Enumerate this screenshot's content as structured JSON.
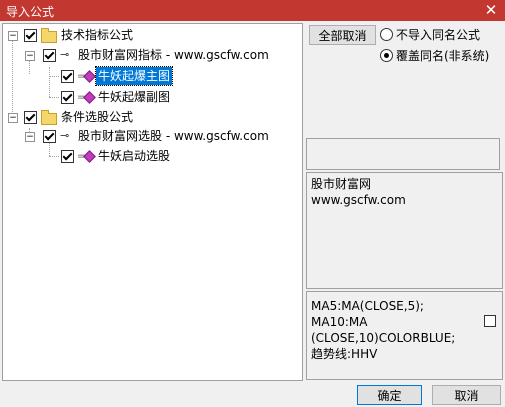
{
  "window": {
    "title": "导入公式",
    "close_glyph": "✕"
  },
  "tree": {
    "nodes": [
      {
        "label": "技术指标公式"
      },
      {
        "label": "股市财富网指标 - www.gscfw.com"
      },
      {
        "label": "牛妖起爆主图",
        "selected": true
      },
      {
        "label": "牛妖起爆副图"
      },
      {
        "label": "条件选股公式"
      },
      {
        "label": "股市财富网选股 - www.gscfw.com"
      },
      {
        "label": "牛妖启动选股"
      }
    ]
  },
  "options": {
    "cancel_all_label": "全部取消",
    "radio_no_import": "不导入同名公式",
    "radio_overwrite": "覆盖同名(非系统)",
    "selected_radio": "overwrite"
  },
  "info_text": {
    "line1": "股市财富网",
    "line2": "www.gscfw.com"
  },
  "formula_text": {
    "line1": "MA5:MA(CLOSE,5);",
    "line2": "MA10:MA",
    "line3": "(CLOSE,10)COLORBLUE;",
    "line4": "趋势线:HHV"
  },
  "footer": {
    "ok_label": "确定",
    "cancel_label": "取消"
  },
  "colors": {
    "titlebar": "#c2372f",
    "selection": "#0078d7",
    "formula_icon": "#c13bc0",
    "folder": "#f5d66b"
  }
}
